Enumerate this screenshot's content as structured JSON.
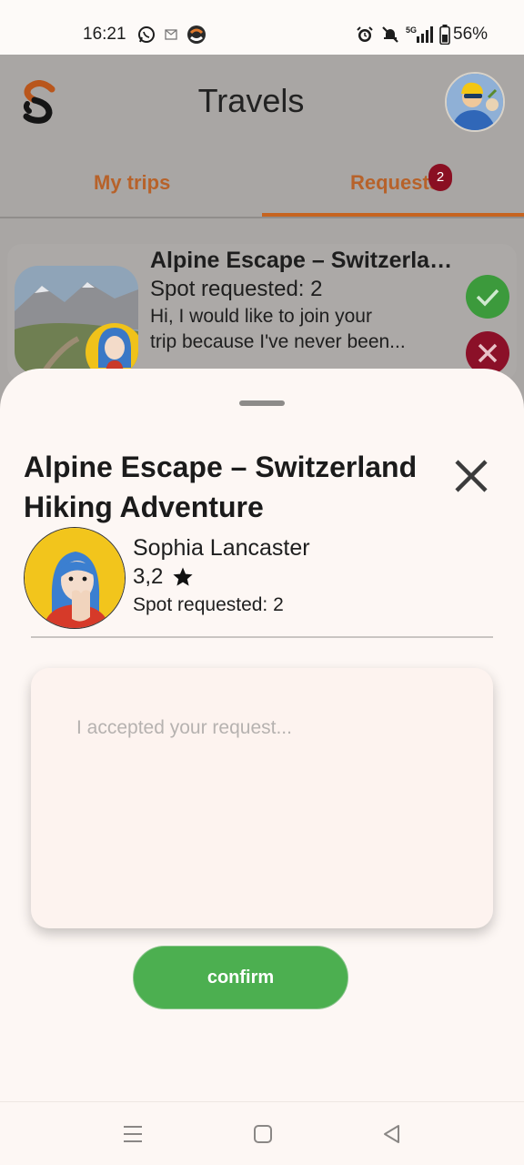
{
  "status_bar": {
    "time": "16:21",
    "network": "5G",
    "battery": "56%",
    "icons": [
      "whatsapp-icon",
      "mail-icon",
      "app-logo-icon",
      "alarm-icon",
      "mute-icon",
      "signal-icon",
      "battery-icon"
    ]
  },
  "header": {
    "title": "Travels"
  },
  "tabs": [
    {
      "label": "My trips",
      "active": false
    },
    {
      "label": "Requests",
      "active": true,
      "badge": "2"
    }
  ],
  "request_card": {
    "title": "Alpine Escape – Switzerland Hiking Adventure",
    "spot": "Spot requested: 2",
    "message_line1": "Hi, I would like to join your",
    "message_line2": "trip because I've never been..."
  },
  "sheet": {
    "title": "Alpine Escape – Switzerland Hiking Adventure",
    "user": {
      "name": "Sophia Lancaster",
      "rating": "3,2",
      "spot": "Spot requested: 2"
    },
    "message_placeholder": "I accepted your request...",
    "confirm_label": "confirm"
  },
  "colors": {
    "accent": "#c66420",
    "confirm": "#4caf50",
    "accept": "#3c9a3c",
    "reject": "#8b1028",
    "sheet_bg": "#fdf7f4"
  }
}
